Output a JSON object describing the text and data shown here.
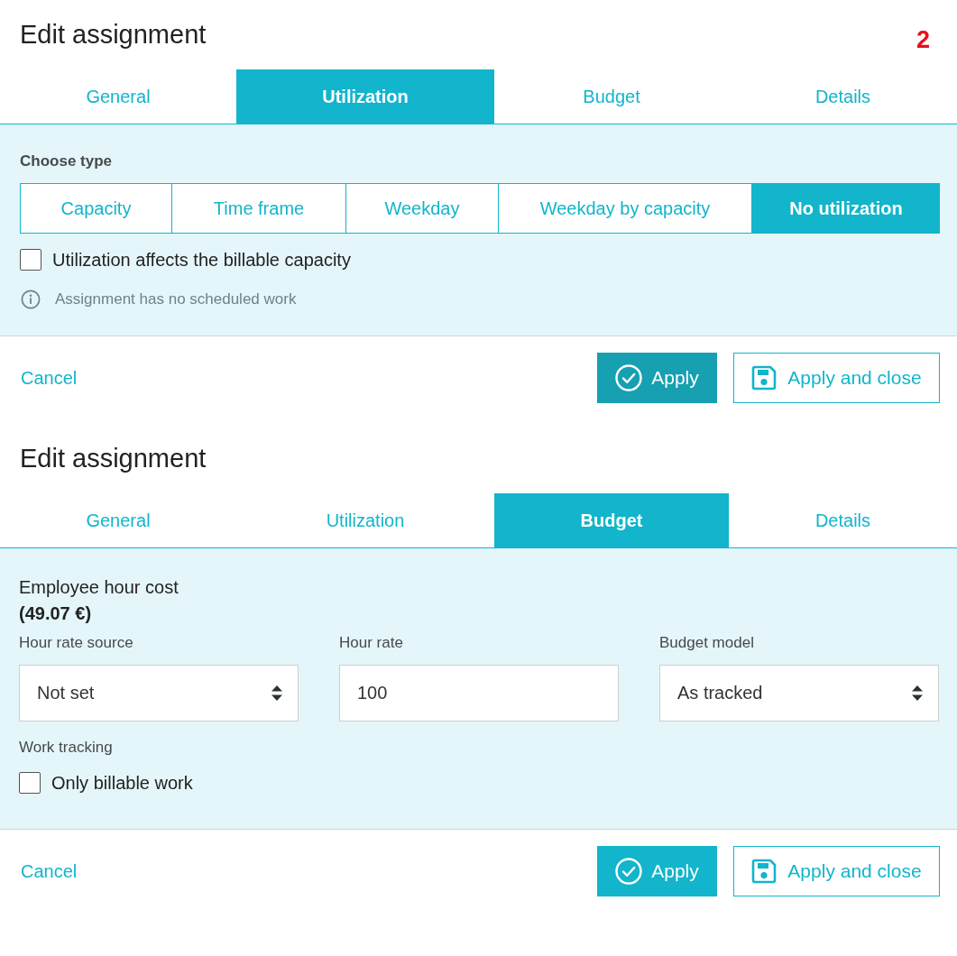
{
  "step_marker": {
    "label": "2"
  },
  "panels": [
    {
      "kind": "utilization",
      "title": "Edit assignment",
      "tabs": [
        {
          "label": "General",
          "selected": false
        },
        {
          "label": "Utilization",
          "selected": true
        },
        {
          "label": "Budget",
          "selected": false
        },
        {
          "label": "Details",
          "selected": false
        }
      ],
      "body": {
        "choose_type": {
          "label": "Choose type",
          "options": [
            {
              "label": "Capacity",
              "selected": false
            },
            {
              "label": "Time frame",
              "selected": false
            },
            {
              "label": "Weekday",
              "selected": false
            },
            {
              "label": "Weekday by capacity",
              "selected": false
            },
            {
              "label": "No utilization",
              "selected": true
            }
          ]
        },
        "checkbox": {
          "label": "Utilization affects the billable capacity",
          "checked": false
        },
        "info": "Assignment has no scheduled work"
      },
      "footer": {
        "cancel": "Cancel",
        "buttons": [
          {
            "kind": "primary",
            "label": "Apply",
            "highlighted": true
          },
          {
            "kind": "secondary",
            "label": "Apply and close"
          }
        ]
      }
    },
    {
      "kind": "budget",
      "title": "Edit assignment",
      "tabs": [
        {
          "label": "General",
          "selected": false
        },
        {
          "label": "Utilization",
          "selected": false
        },
        {
          "label": "Budget",
          "selected": true
        },
        {
          "label": "Details",
          "selected": false
        }
      ],
      "body": {
        "cost": {
          "label": "Employee hour cost",
          "value": "(49.07 €)"
        },
        "fields": [
          {
            "kind": "select",
            "label": "Hour rate source",
            "value": "Not set"
          },
          {
            "kind": "input",
            "label": "Hour rate",
            "value": "100"
          },
          {
            "kind": "select",
            "label": "Budget model",
            "value": "As tracked"
          }
        ],
        "work_tracking": {
          "label": "Work tracking",
          "checkbox": {
            "label": "Only billable work",
            "checked": false
          }
        }
      },
      "footer": {
        "cancel": "Cancel",
        "buttons": [
          {
            "kind": "primary",
            "label": "Apply",
            "highlighted": false
          },
          {
            "kind": "secondary",
            "label": "Apply and close"
          }
        ]
      }
    }
  ]
}
